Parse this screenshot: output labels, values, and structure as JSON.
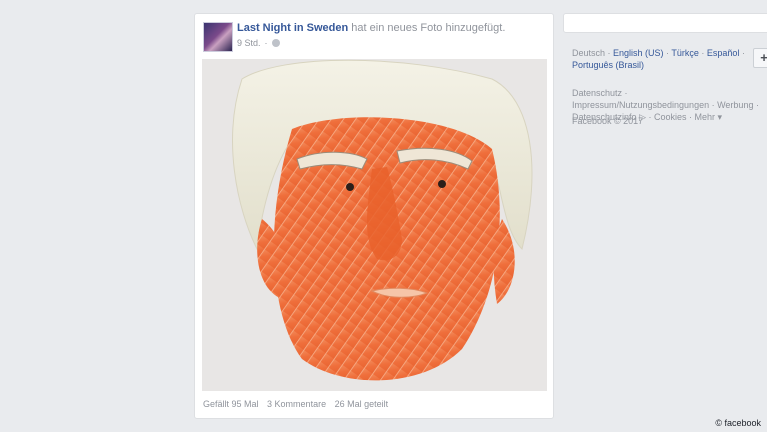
{
  "post": {
    "page_name": "Last Night in Sweden",
    "action_text": "hat ein neues Foto hinzugefügt.",
    "timestamp": "9 Std.",
    "privacy_icon": "globe-icon",
    "photo_description_icon": "salmon-face-photo",
    "stats": {
      "likes": "Gefällt 95 Mal",
      "comments": "3 Kommentare",
      "shares": "26 Mal geteilt"
    }
  },
  "sidebar": {
    "languages": {
      "current": "Deutsch",
      "others": [
        "English (US)",
        "Türkçe",
        "Español",
        "Português (Brasil)"
      ],
      "add_button": "+"
    },
    "footer_links": [
      "Datenschutz",
      "Impressum/Nutzungsbedingungen",
      "Werbung",
      "Datenschutzinfo",
      "Cookies",
      "Mehr"
    ],
    "copyright": "Facebook © 2017"
  },
  "watermark": "© facebook",
  "colors": {
    "background": "#e9ebee",
    "link": "#365899",
    "muted": "#90949c",
    "salmon": "#f07a4a"
  }
}
